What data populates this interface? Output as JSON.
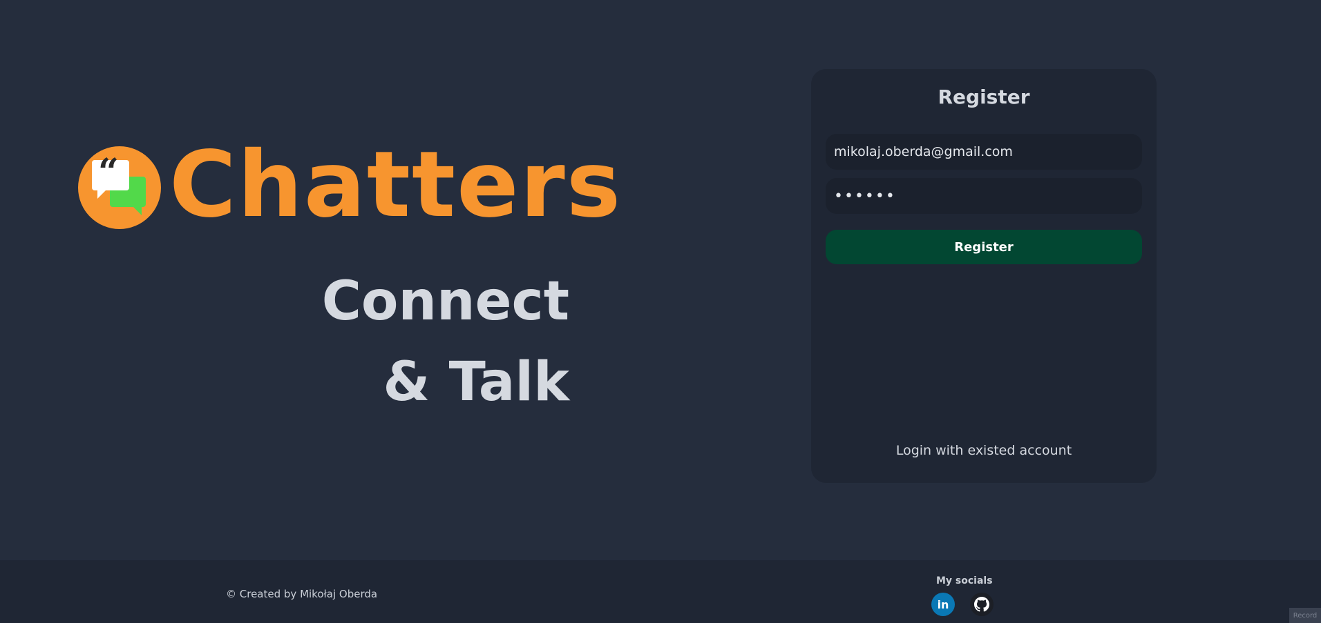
{
  "brand": {
    "name": "Chatters",
    "logo_icon": "chat-bubbles-icon",
    "logo_quote": "“",
    "tagline_line1": "Connect",
    "tagline_line2": "& Talk",
    "brand_color": "#f7952f"
  },
  "register": {
    "title": "Register",
    "email_value": "mikolaj.oberda@gmail.com",
    "password_value": "••••••",
    "submit_label": "Register",
    "login_link": "Login with existed account",
    "accent_color": "#024732"
  },
  "footer": {
    "credit": "© Created by Mikołaj Oberda",
    "socials_title": "My socials",
    "linkedin_label": "in",
    "linkedin_icon": "linkedin-icon",
    "github_icon": "github-icon",
    "record_badge": "Record"
  }
}
